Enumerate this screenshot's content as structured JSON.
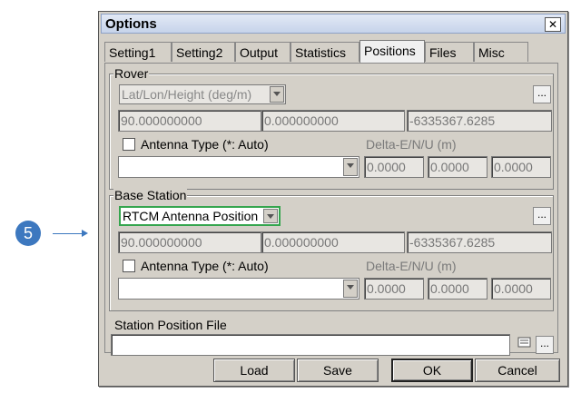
{
  "annotation": {
    "number": "5"
  },
  "dialog": {
    "title": "Options",
    "close_label": "✕"
  },
  "tabs": [
    {
      "label": "Setting1"
    },
    {
      "label": "Setting2"
    },
    {
      "label": "Output"
    },
    {
      "label": "Statistics"
    },
    {
      "label": "Positions",
      "active": true
    },
    {
      "label": "Files"
    },
    {
      "label": "Misc"
    }
  ],
  "rover": {
    "legend": "Rover",
    "format": "Lat/Lon/Height (deg/m)",
    "browse_label": "...",
    "lat": "90.000000000",
    "lon": "0.000000000",
    "height": "-6335367.6285",
    "antenna_label": "Antenna Type (*: Auto)",
    "delta_label": "Delta-E/N/U (m)",
    "antenna_value": "",
    "delta_e": "0.0000",
    "delta_n": "0.0000",
    "delta_u": "0.0000"
  },
  "base": {
    "legend": "Base Station",
    "format": "RTCM Antenna Position",
    "browse_label": "...",
    "lat": "90.000000000",
    "lon": "0.000000000",
    "height": "-6335367.6285",
    "antenna_label": "Antenna Type (*: Auto)",
    "delta_label": "Delta-E/N/U (m)",
    "antenna_value": "",
    "delta_e": "0.0000",
    "delta_n": "0.0000",
    "delta_u": "0.0000"
  },
  "station_file": {
    "label": "Station Position File",
    "value": "",
    "view_icon": "document-icon",
    "browse_label": "..."
  },
  "buttons": {
    "load": "Load",
    "save": "Save",
    "ok": "OK",
    "cancel": "Cancel"
  }
}
